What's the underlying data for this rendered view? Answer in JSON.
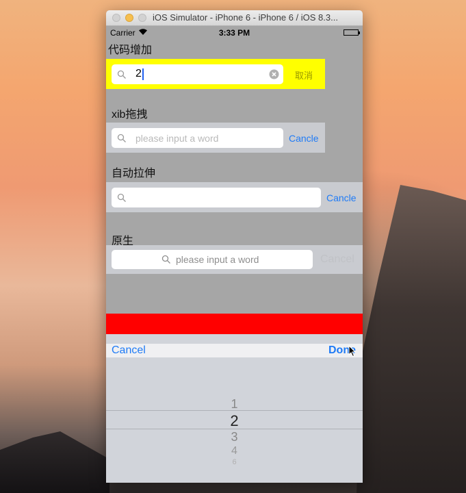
{
  "window": {
    "title": "iOS Simulator - iPhone 6 - iPhone 6 / iOS 8.3..."
  },
  "status_bar": {
    "carrier": "Carrier",
    "time": "3:33 PM"
  },
  "section1": {
    "label": "代码增加",
    "search_value": "2",
    "cancel_label": "取消"
  },
  "section2": {
    "label": "xib拖拽",
    "placeholder": "please input a word",
    "cancel_label": "Cancle"
  },
  "section3": {
    "label": "自动拉伸",
    "cancel_label": "Cancle"
  },
  "section4": {
    "label": "原生",
    "placeholder": "please input a word",
    "cancel_label": "Cancel"
  },
  "picker_toolbar": {
    "cancel_label": "Cancel",
    "done_label": "Done"
  },
  "picker": {
    "rows": [
      "1",
      "2",
      "3",
      "4",
      "6"
    ],
    "selected": "2"
  },
  "colors": {
    "screen_bg": "#a6a6a6",
    "section1_bar_bg": "#ffff00",
    "section1_cancel": "#999900",
    "tint": "#1f7bf6",
    "red_band": "#ff0000",
    "picker_bg": "#d1d4da"
  }
}
